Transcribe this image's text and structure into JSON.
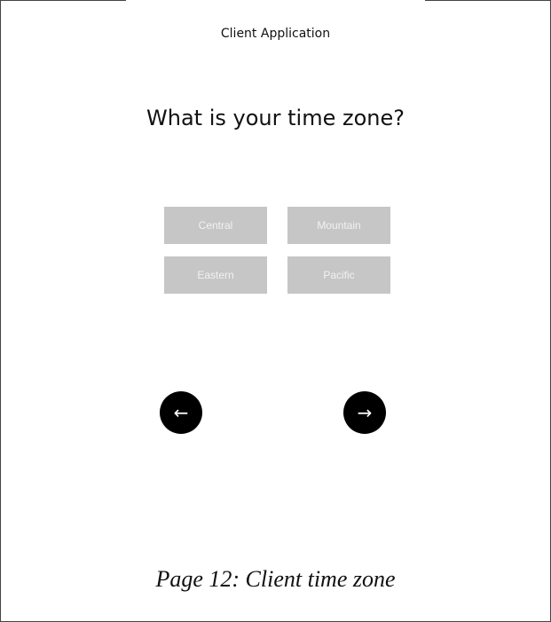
{
  "app": {
    "title": "Client Application"
  },
  "question": "What is your time zone?",
  "options": [
    {
      "label": "Central"
    },
    {
      "label": "Mountain"
    },
    {
      "label": "Eastern"
    },
    {
      "label": "Pacific"
    }
  ],
  "nav": {
    "prev_icon": "←",
    "next_icon": "→"
  },
  "caption": "Page 12: Client time zone",
  "colors": {
    "option_bg": "#c6c6c6",
    "nav_bg": "#000000"
  }
}
